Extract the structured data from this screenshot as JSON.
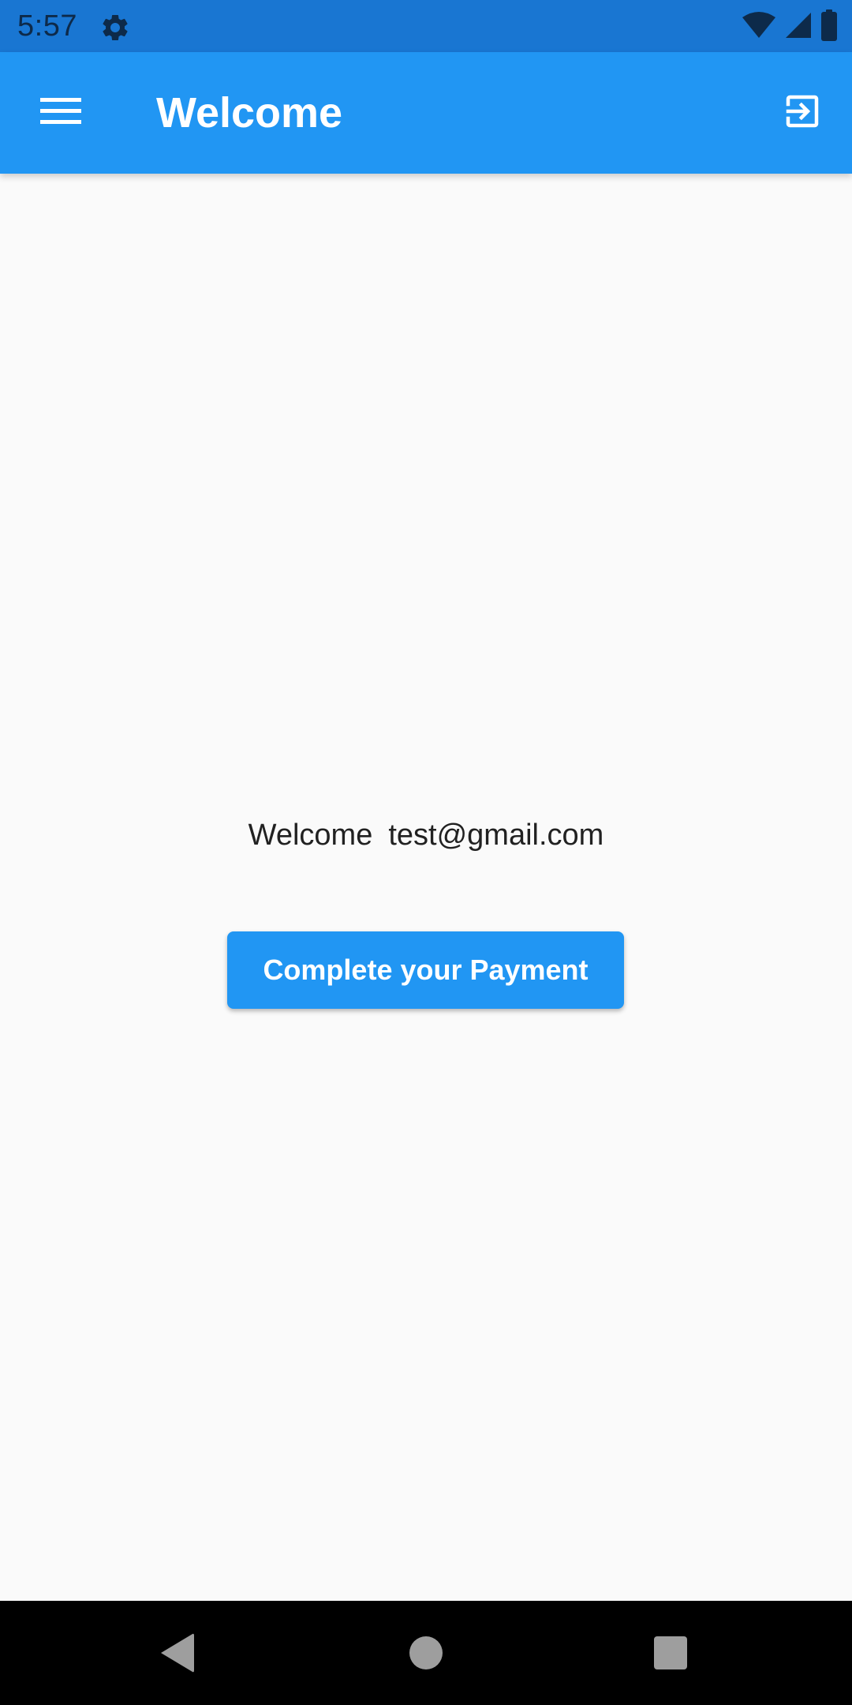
{
  "status_bar": {
    "time": "5:57",
    "icons": [
      "settings-gear-icon",
      "wifi-icon",
      "cellular-signal-icon",
      "battery-icon"
    ]
  },
  "app_bar": {
    "title": "Welcome",
    "menu_icon": "hamburger-menu-icon",
    "action_icon": "exit-to-app-icon",
    "color": "#2196f3"
  },
  "main": {
    "welcome_prefix": "Welcome",
    "user_email": "test@gmail.com",
    "payment_button_label": "Complete your Payment"
  },
  "nav_bar": {
    "icons": [
      "back-icon",
      "home-icon",
      "recents-icon"
    ]
  },
  "colors": {
    "status_bar": "#1976d2",
    "primary": "#2196f3",
    "background": "#fafafa",
    "text": "#212121"
  }
}
